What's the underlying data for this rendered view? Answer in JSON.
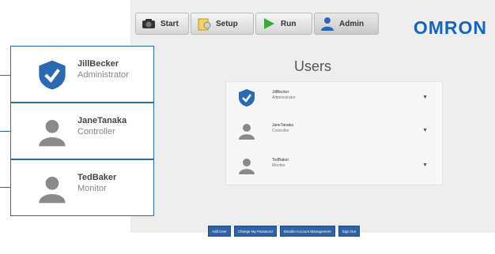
{
  "nav": {
    "tabs": [
      {
        "label": "Start",
        "icon": "camera-icon"
      },
      {
        "label": "Setup",
        "icon": "setup-icon"
      },
      {
        "label": "Run",
        "icon": "play-icon"
      },
      {
        "label": "Admin",
        "icon": "user-admin-icon"
      }
    ],
    "logo": "OMRON"
  },
  "users_screen": {
    "title": "Users",
    "users": [
      {
        "name": "JillBecker",
        "role": "Administrator"
      },
      {
        "name": "JaneTanaka",
        "role": "Controller"
      },
      {
        "name": "TedBaker",
        "role": "Monitor"
      }
    ],
    "buttons": [
      "Add User",
      "Change My Password",
      "Disable Account Management",
      "Sign Out"
    ]
  },
  "callouts": [
    {
      "name": "JillBecker",
      "role": "Administrator"
    },
    {
      "name": "JaneTanaka",
      "role": "Controller"
    },
    {
      "name": "TedBaker",
      "role": "Monitor"
    }
  ],
  "colors": {
    "accent": "#2a6ab3",
    "button": "#2f62a6",
    "shield": "#2a6ab3",
    "avatar": "#8a8a8a"
  }
}
